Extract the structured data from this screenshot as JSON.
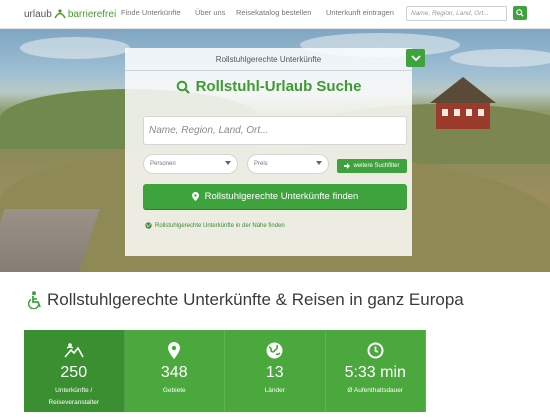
{
  "logo": {
    "part1": "urlaub",
    "part2": "barrierefrei"
  },
  "nav": {
    "links": [
      "Finde Unterkünfte",
      "Über uns",
      "Reisekatalog bestellen",
      "Unterkunft eintragen"
    ],
    "search_placeholder": "Name, Region, Land, Ort..."
  },
  "panel": {
    "header": "Rollstuhlgerechte Unterkünfte",
    "title": "Rollstuhl-Urlaub Suche",
    "input_placeholder": "Name, Region, Land, Ort...",
    "persons_label": "Personen",
    "price_label": "Preis",
    "more_filters_label": "weitere Suchfilter",
    "find_button_label": "Rollstuhlgerechte Unterkünfte finden",
    "nearby_link": "Rollstuhlgerechte Unterkünfte in der Nähe finden"
  },
  "main": {
    "heading": "Rollstuhlgerechte Unterkünfte & Reisen in ganz Europa"
  },
  "stats": [
    {
      "value": "250",
      "label_line1": "Unterkünfte /",
      "label_line2": "Reiseveranstalter",
      "icon": "mountain-person-icon"
    },
    {
      "value": "348",
      "label_line1": "Gebiete",
      "label_line2": "",
      "icon": "map-pin-icon"
    },
    {
      "value": "13",
      "label_line1": "Länder",
      "label_line2": "",
      "icon": "globe-icon"
    },
    {
      "value": "5:33 min",
      "label_line1": "Ø Aufenthaltsdauer",
      "label_line2": "",
      "icon": "clock-icon"
    }
  ],
  "colors": {
    "brand_green": "#3ea33d",
    "stat_bg": "#4aa83c",
    "stat_first_bg": "#3a8f30"
  }
}
